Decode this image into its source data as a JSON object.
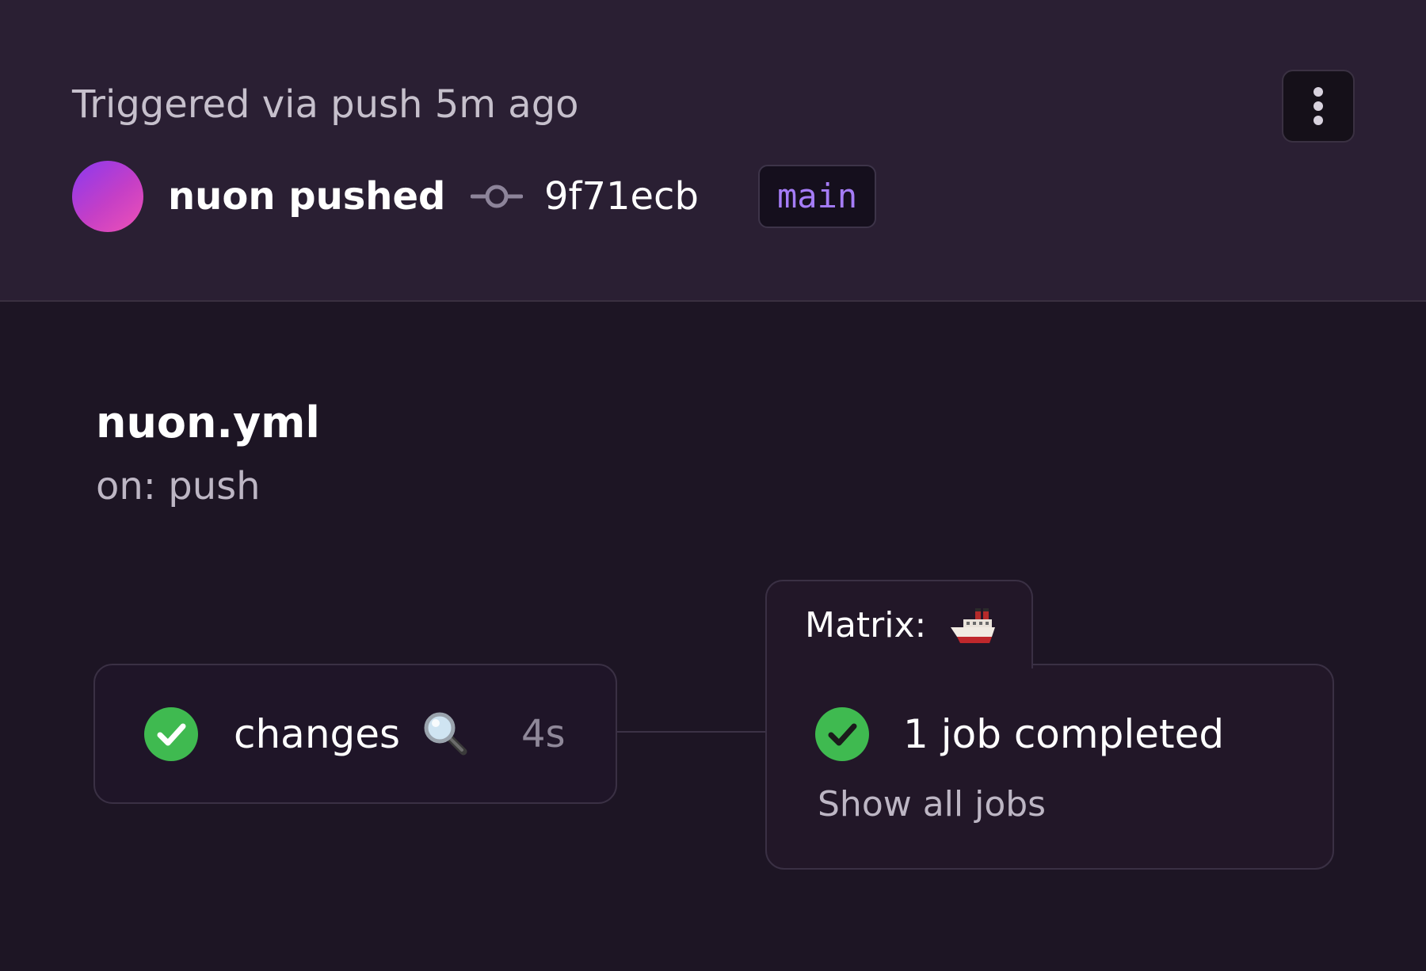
{
  "header": {
    "trigger_text": "Triggered via push 5m ago",
    "menu_icon": "kebab-vertical-icon",
    "actor_text": "nuon pushed",
    "commit_icon": "git-commit-icon",
    "commit_sha": "9f71ecb",
    "branch": "main"
  },
  "workflow": {
    "name": "nuon.yml",
    "trigger": "on: push"
  },
  "jobs": {
    "changes": {
      "status_icon": "check-circle-icon",
      "name": "changes",
      "emoji_icon": "magnifying-glass-icon",
      "duration": "4s"
    },
    "matrix": {
      "label": "Matrix:",
      "emoji_icon": "ship-icon",
      "status_icon": "check-circle-icon",
      "status_text": "1 job completed",
      "show_all_label": "Show all jobs"
    }
  },
  "colors": {
    "header_bg": "#2a1f33",
    "page_bg": "#1d1524",
    "success": "#3fba50",
    "branch_text": "#a57cf7",
    "avatar_gradient": [
      "#8a39f0",
      "#f052b6"
    ]
  }
}
